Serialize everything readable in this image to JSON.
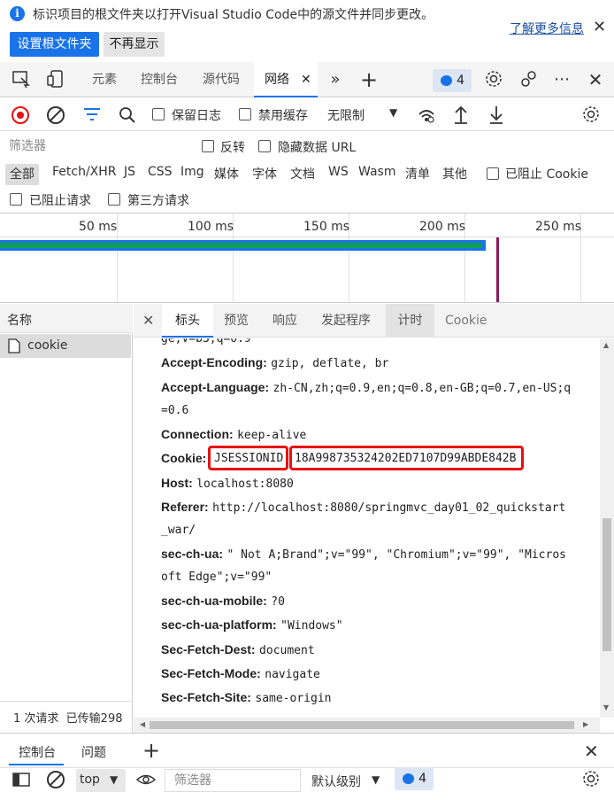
{
  "banner": {
    "message": "标识项目的根文件夹以打开Visual Studio Code中的源文件并同步更改。",
    "learn_more": "了解更多信息",
    "primary_button": "设置根文件夹",
    "secondary_button": "不再显示",
    "info_icon": "i"
  },
  "main_tabs": {
    "elements": "元素",
    "console": "控制台",
    "sources": "源代码",
    "network": "网络",
    "issues_count": "4"
  },
  "toolbar": {
    "preserve_log": "保留日志",
    "disable_cache": "禁用缓存",
    "throttling": "无限制"
  },
  "filter_row": {
    "placeholder": "筛选器",
    "invert": "反转",
    "hide_data_urls": "隐藏数据 URL"
  },
  "type_filters": [
    "全部",
    "Fetch/XHR",
    "JS",
    "CSS",
    "Img",
    "媒体",
    "字体",
    "文档",
    "WS",
    "Wasm",
    "清单",
    "其他"
  ],
  "blocked_cookies": "已阻止 Cookie",
  "blocked_requests": "已阻止请求",
  "third_party": "第三方请求",
  "timeline": {
    "ticks": [
      "50 ms",
      "100 ms",
      "150 ms",
      "200 ms",
      "250 ms"
    ],
    "colors": {
      "bar_blue": "#1a73e8",
      "bar_green": "#0f9d58",
      "marker": "#8b1a5a"
    }
  },
  "requests": {
    "column_name": "名称",
    "items": [
      "cookie"
    ],
    "summary": "1 次请求  已传输298"
  },
  "details": {
    "tabs": [
      "标头",
      "预览",
      "响应",
      "发起程序",
      "计时",
      "Cookie"
    ],
    "cut_line": "ge;v=b3;q=0.9",
    "headers": [
      {
        "k": "Accept-Encoding:",
        "v": "gzip, deflate, br"
      },
      {
        "k": "Accept-Language:",
        "v": "zh-CN,zh;q=0.9,en;q=0.8,en-GB;q=0.7,en-US;q"
      },
      {
        "k": "",
        "v": "=0.6"
      },
      {
        "k": "Connection:",
        "v": "keep-alive"
      },
      {
        "k": "Cookie:",
        "v": "JSESSIONID",
        "v2": "18A998735324202ED7107D99ABDE842B"
      },
      {
        "k": "Host:",
        "v": "localhost:8080"
      },
      {
        "k": "Referer:",
        "v": "http://localhost:8080/springmvc_day01_02_quickstart"
      },
      {
        "k": "",
        "v": "_war/"
      },
      {
        "k": "sec-ch-ua:",
        "v": "\" Not A;Brand\";v=\"99\", \"Chromium\";v=\"99\", \"Micros"
      },
      {
        "k": "",
        "v": "oft Edge\";v=\"99\""
      },
      {
        "k": "sec-ch-ua-mobile:",
        "v": "?0"
      },
      {
        "k": "sec-ch-ua-platform:",
        "v": "\"Windows\""
      },
      {
        "k": "Sec-Fetch-Dest:",
        "v": "document"
      },
      {
        "k": "Sec-Fetch-Mode:",
        "v": "navigate"
      },
      {
        "k": "Sec-Fetch-Site:",
        "v": "same-origin"
      }
    ]
  },
  "drawer": {
    "console_tab": "控制台",
    "issues_tab": "问题",
    "context": "top",
    "filter_placeholder": "筛选器",
    "level": "默认级别",
    "issues_count": "4"
  }
}
